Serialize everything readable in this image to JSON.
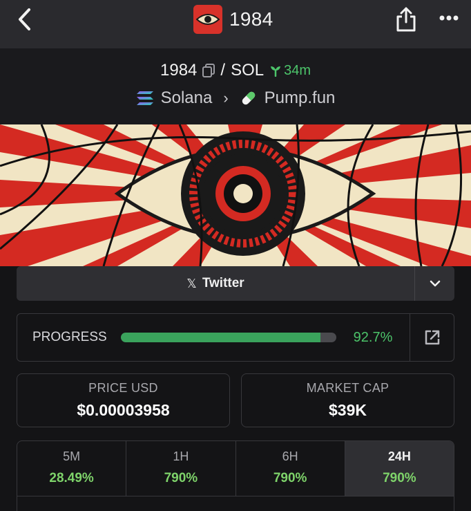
{
  "header": {
    "title": "1984",
    "icons": {
      "back": "chevron-left-icon",
      "share": "share-icon",
      "more": "more-horizontal-icon"
    }
  },
  "pair": {
    "base": "1984",
    "separator": "/",
    "quote": "SOL",
    "age": "34m",
    "chain": "Solana",
    "dex": "Pump.fun"
  },
  "socials": {
    "twitter_label": "Twitter"
  },
  "progress": {
    "label": "PROGRESS",
    "percent_text": "92.7%",
    "fraction": 0.927
  },
  "stats": {
    "price_label": "PRICE USD",
    "price_value": "$0.00003958",
    "mcap_label": "MARKET CAP",
    "mcap_value": "$39K"
  },
  "periods": [
    {
      "label": "5M",
      "value": "28.49%"
    },
    {
      "label": "1H",
      "value": "790%"
    },
    {
      "label": "6H",
      "value": "790%"
    },
    {
      "label": "24H",
      "value": "790%"
    }
  ],
  "colors": {
    "accent_green": "#4cc46a",
    "brand_red": "#d8322a",
    "change_green": "#7ed36a"
  }
}
